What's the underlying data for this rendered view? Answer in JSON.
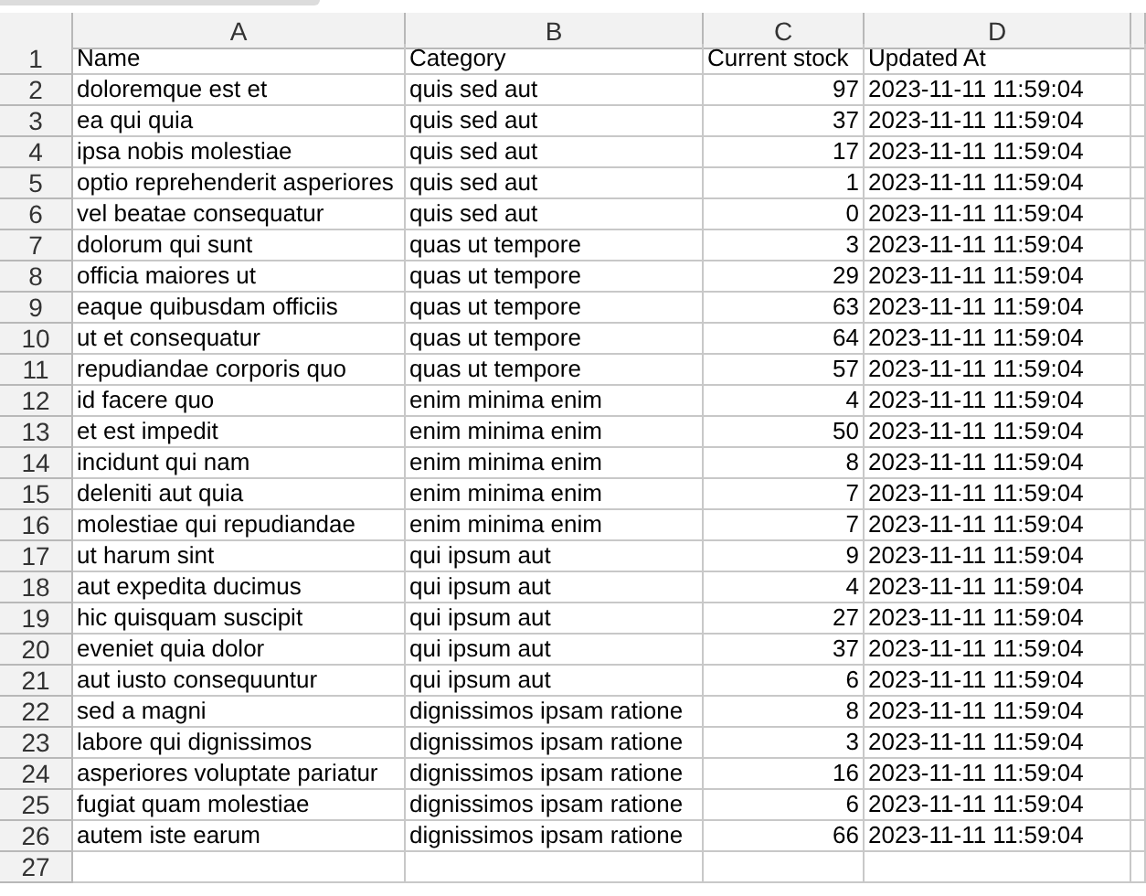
{
  "columns": [
    "A",
    "B",
    "C",
    "D"
  ],
  "header": {
    "number": "1",
    "cells": [
      "Name",
      "Category",
      "Current stock",
      "Updated At"
    ]
  },
  "rows": [
    {
      "number": "2",
      "cells": [
        "doloremque est et",
        "quis sed aut",
        "97",
        "2023-11-11 11:59:04"
      ]
    },
    {
      "number": "3",
      "cells": [
        "ea qui quia",
        "quis sed aut",
        "37",
        "2023-11-11 11:59:04"
      ]
    },
    {
      "number": "4",
      "cells": [
        "ipsa nobis molestiae",
        "quis sed aut",
        "17",
        "2023-11-11 11:59:04"
      ]
    },
    {
      "number": "5",
      "cells": [
        "optio reprehenderit asperiores",
        "quis sed aut",
        "1",
        "2023-11-11 11:59:04"
      ]
    },
    {
      "number": "6",
      "cells": [
        "vel beatae consequatur",
        "quis sed aut",
        "0",
        "2023-11-11 11:59:04"
      ]
    },
    {
      "number": "7",
      "cells": [
        "dolorum qui sunt",
        "quas ut tempore",
        "3",
        "2023-11-11 11:59:04"
      ]
    },
    {
      "number": "8",
      "cells": [
        "officia maiores ut",
        "quas ut tempore",
        "29",
        "2023-11-11 11:59:04"
      ]
    },
    {
      "number": "9",
      "cells": [
        "eaque quibusdam officiis",
        "quas ut tempore",
        "63",
        "2023-11-11 11:59:04"
      ]
    },
    {
      "number": "10",
      "cells": [
        "ut et consequatur",
        "quas ut tempore",
        "64",
        "2023-11-11 11:59:04"
      ]
    },
    {
      "number": "11",
      "cells": [
        "repudiandae corporis quo",
        "quas ut tempore",
        "57",
        "2023-11-11 11:59:04"
      ]
    },
    {
      "number": "12",
      "cells": [
        "id facere quo",
        "enim minima enim",
        "4",
        "2023-11-11 11:59:04"
      ]
    },
    {
      "number": "13",
      "cells": [
        "et est impedit",
        "enim minima enim",
        "50",
        "2023-11-11 11:59:04"
      ]
    },
    {
      "number": "14",
      "cells": [
        "incidunt qui nam",
        "enim minima enim",
        "8",
        "2023-11-11 11:59:04"
      ]
    },
    {
      "number": "15",
      "cells": [
        "deleniti aut quia",
        "enim minima enim",
        "7",
        "2023-11-11 11:59:04"
      ]
    },
    {
      "number": "16",
      "cells": [
        "molestiae qui repudiandae",
        "enim minima enim",
        "7",
        "2023-11-11 11:59:04"
      ]
    },
    {
      "number": "17",
      "cells": [
        "ut harum sint",
        "qui ipsum aut",
        "9",
        "2023-11-11 11:59:04"
      ]
    },
    {
      "number": "18",
      "cells": [
        "aut expedita ducimus",
        "qui ipsum aut",
        "4",
        "2023-11-11 11:59:04"
      ]
    },
    {
      "number": "19",
      "cells": [
        "hic quisquam suscipit",
        "qui ipsum aut",
        "27",
        "2023-11-11 11:59:04"
      ]
    },
    {
      "number": "20",
      "cells": [
        "eveniet quia dolor",
        "qui ipsum aut",
        "37",
        "2023-11-11 11:59:04"
      ]
    },
    {
      "number": "21",
      "cells": [
        "aut iusto consequuntur",
        "qui ipsum aut",
        "6",
        "2023-11-11 11:59:04"
      ]
    },
    {
      "number": "22",
      "cells": [
        "sed a magni",
        "dignissimos ipsam ratione",
        "8",
        "2023-11-11 11:59:04"
      ]
    },
    {
      "number": "23",
      "cells": [
        "labore qui dignissimos",
        "dignissimos ipsam ratione",
        "3",
        "2023-11-11 11:59:04"
      ]
    },
    {
      "number": "24",
      "cells": [
        "asperiores voluptate pariatur",
        "dignissimos ipsam ratione",
        "16",
        "2023-11-11 11:59:04"
      ]
    },
    {
      "number": "25",
      "cells": [
        "fugiat quam molestiae",
        "dignissimos ipsam ratione",
        "6",
        "2023-11-11 11:59:04"
      ]
    },
    {
      "number": "26",
      "cells": [
        "autem iste earum",
        "dignissimos ipsam ratione",
        "66",
        "2023-11-11 11:59:04"
      ]
    }
  ],
  "empty_rows": [
    {
      "number": "27"
    }
  ]
}
